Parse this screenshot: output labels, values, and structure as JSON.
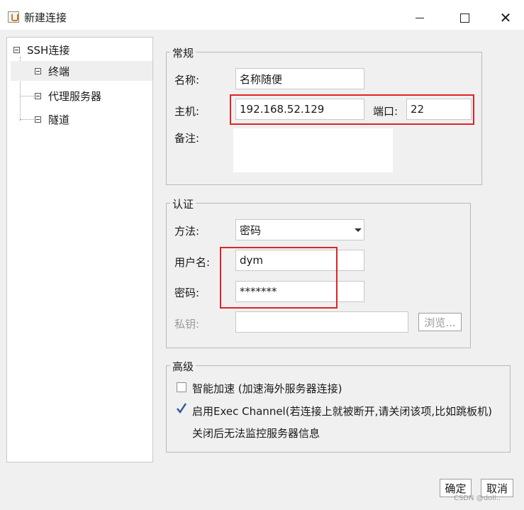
{
  "window": {
    "title": "新建连接",
    "controls": {
      "minimize": "—",
      "maximize": "☐",
      "close": "✕"
    }
  },
  "sidebar": {
    "items": [
      {
        "label": "SSH连接",
        "icon": "collapse-toggle-icon"
      },
      {
        "label": "终端",
        "icon": "collapse-toggle-icon"
      },
      {
        "label": "代理服务器",
        "icon": "collapse-toggle-icon"
      },
      {
        "label": "隧道",
        "icon": "collapse-toggle-icon"
      }
    ]
  },
  "general": {
    "legend": "常规",
    "name_label": "名称:",
    "name_value": "名称随便",
    "host_label": "主机:",
    "host_value": "192.168.52.129",
    "port_label": "端口:",
    "port_value": "22",
    "note_label": "备注:",
    "note_value": ""
  },
  "auth": {
    "legend": "认证",
    "method_label": "方法:",
    "method_value": "密码",
    "username_label": "用户名:",
    "username_value": "dym",
    "password_label": "密码:",
    "password_value": "*******",
    "private_key_label": "私钥:",
    "private_key_value": "",
    "browse_button": "浏览..."
  },
  "advanced": {
    "legend": "高级",
    "smart_accel_label": "智能加速 (加速海外服务器连接)",
    "smart_accel_checked": false,
    "exec_channel_label": "启用Exec Channel(若连接上就被断开,请关闭该项,比如跳板机)",
    "exec_channel_checked": true,
    "exec_channel_note": "关闭后无法监控服务器信息"
  },
  "footer": {
    "ok_button": "确定",
    "cancel_button": "取消",
    "watermark": "CSDN @doll.."
  },
  "colors": {
    "highlight_box": "#e02424",
    "check_mark": "#2b5797"
  }
}
